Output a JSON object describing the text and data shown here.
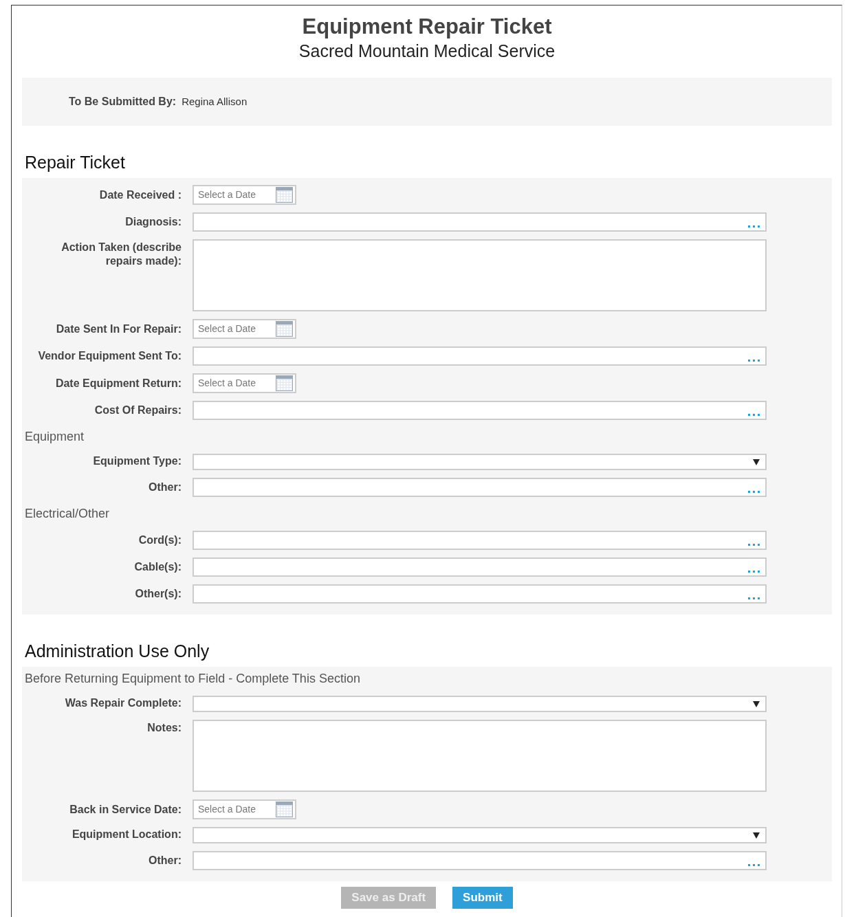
{
  "title": "Equipment Repair Ticket",
  "subtitle": "Sacred Mountain Medical Service",
  "submitter": {
    "label": "To Be Submitted By:",
    "value": "Regina Allison"
  },
  "sections": [
    {
      "heading": "Repair Ticket",
      "rows": [
        {
          "kind": "date",
          "label": "Date Received :",
          "placeholder": "Select a Date"
        },
        {
          "kind": "text",
          "label": "Diagnosis:"
        },
        {
          "kind": "textarea",
          "label": "Action Taken (describe repairs made):"
        },
        {
          "kind": "date",
          "label": "Date Sent In For Repair:",
          "placeholder": "Select a Date"
        },
        {
          "kind": "text",
          "label": "Vendor Equipment Sent To:"
        },
        {
          "kind": "date",
          "label": "Date Equipment Return:",
          "placeholder": "Select a Date"
        },
        {
          "kind": "text",
          "label": "Cost Of Repairs:"
        },
        {
          "kind": "subheading",
          "label": "Equipment"
        },
        {
          "kind": "select",
          "label": "Equipment Type:"
        },
        {
          "kind": "text",
          "label": "Other:"
        },
        {
          "kind": "subheading",
          "label": "Electrical/Other"
        },
        {
          "kind": "text",
          "label": "Cord(s):"
        },
        {
          "kind": "text",
          "label": "Cable(s):"
        },
        {
          "kind": "text",
          "label": "Other(s):"
        }
      ]
    },
    {
      "heading": "Administration Use Only",
      "rows": [
        {
          "kind": "subheading",
          "label": "Before Returning Equipment to Field - Complete This Section"
        },
        {
          "kind": "select",
          "label": "Was Repair Complete:"
        },
        {
          "kind": "textarea",
          "label": "Notes:"
        },
        {
          "kind": "date",
          "label": "Back in Service Date:",
          "placeholder": "Select a Date"
        },
        {
          "kind": "select",
          "label": "Equipment Location:"
        },
        {
          "kind": "text",
          "label": "Other:"
        }
      ]
    }
  ],
  "buttons": [
    {
      "label": "Save as Draft",
      "kind": "secondary"
    },
    {
      "label": "Submit",
      "kind": "primary"
    }
  ]
}
